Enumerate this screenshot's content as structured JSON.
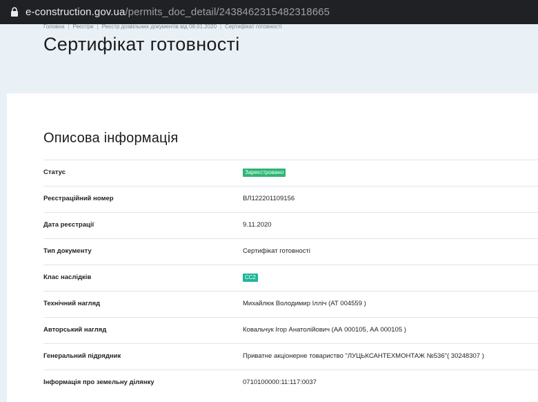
{
  "browser": {
    "url_domain": "e-construction.gov.ua",
    "url_path": "/permits_doc_detail/2438462315482318665"
  },
  "breadcrumb": [
    "Головна",
    "Реєстри",
    "Реєстр дозвільних документів від 08.01.2020",
    "Сертифікат готовності"
  ],
  "page_title": "Сертифікат готовності",
  "section_title": "Описова інформація",
  "rows": [
    {
      "label": "Статус",
      "value": "Зареєстровано"
    },
    {
      "label": "Реєстраційний номер",
      "value": "ВЛ122201109156"
    },
    {
      "label": "Дата реєстрації",
      "value": "9.11.2020"
    },
    {
      "label": "Тип документу",
      "value": "Сертифікат готовності"
    },
    {
      "label": "Клас наслідків",
      "value": "СС2"
    },
    {
      "label": "Технічний нагляд",
      "value": "Михайлюк Володимир Ілліч (АТ 004559 )"
    },
    {
      "label": "Авторський нагляд",
      "value": "Ковальчук Ігор Анатолійович (АА 000105, АА 000105 )"
    },
    {
      "label": "Генеральний підрядник",
      "value": "Приватне акціонерне товариство \"ЛУЦЬКСАНТЕХМОНТАЖ №536\"( 30248307 )"
    },
    {
      "label": "Інформація про земельну ділянку",
      "value": "0710100000:11:117:0037"
    }
  ],
  "colors": {
    "status_badge": "#2bb673",
    "class_badge": "#1fb59a",
    "hero_background": "#e9f0f6"
  }
}
